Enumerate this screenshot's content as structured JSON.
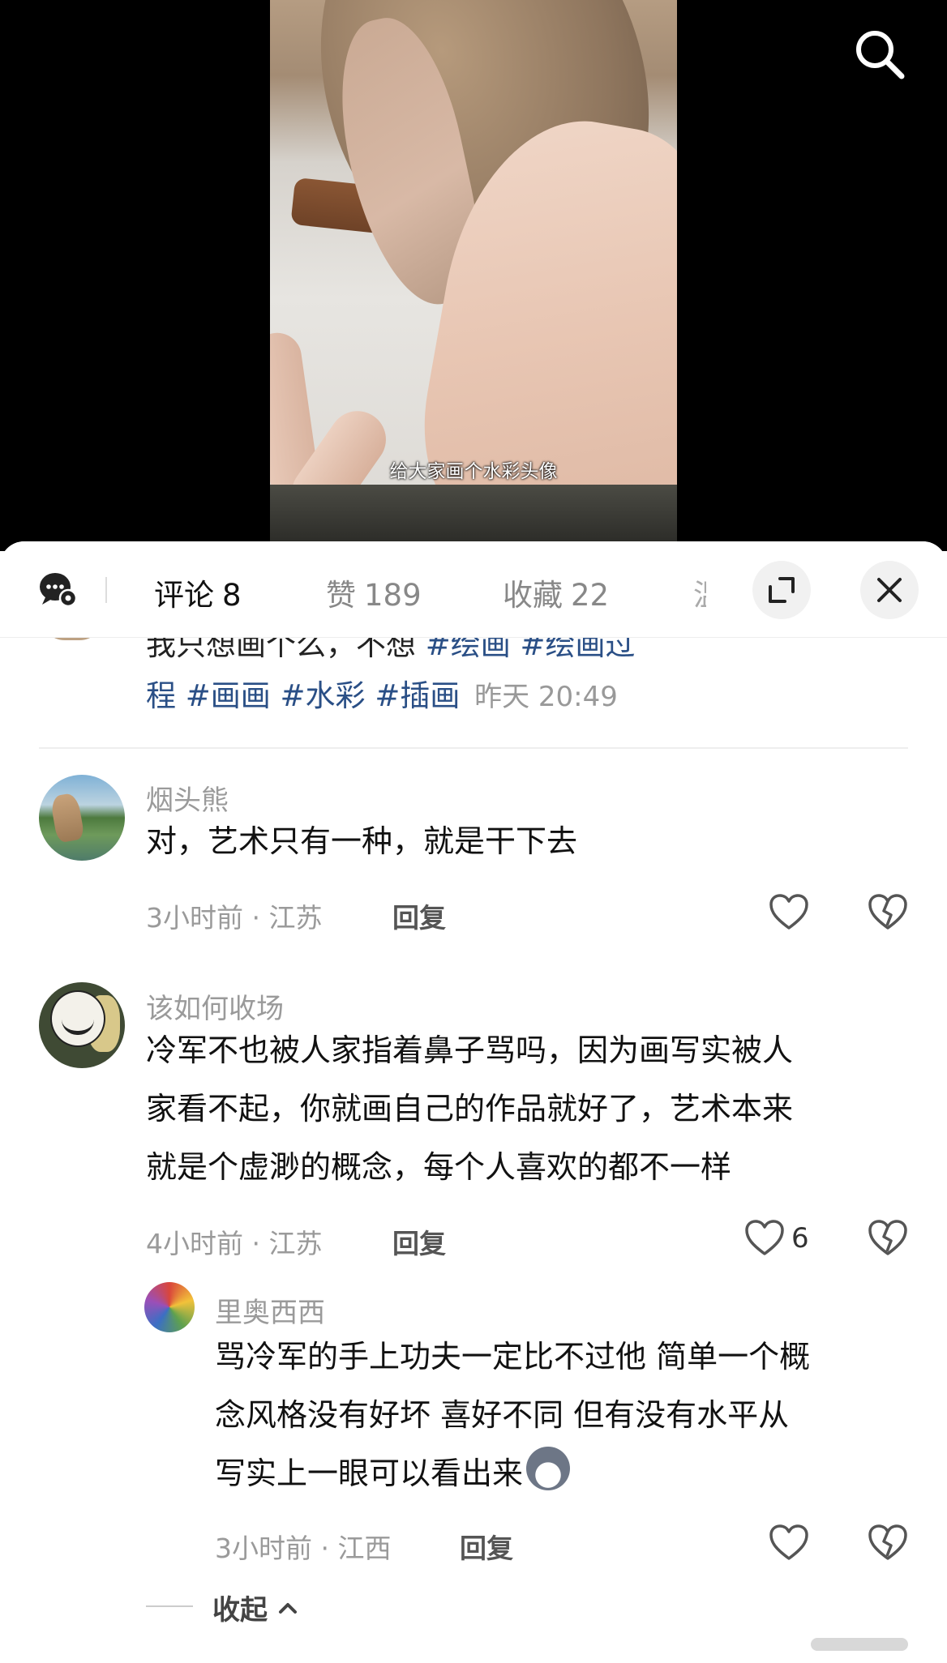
{
  "video": {
    "subtitle": "给大家画个水彩头像"
  },
  "comments_panel": {
    "tabs": [
      {
        "label": "评论",
        "count": "8"
      },
      {
        "label": "赞",
        "count": "189"
      },
      {
        "label": "收藏",
        "count": "22"
      },
      {
        "label": "温",
        "count": ""
      }
    ],
    "post": {
      "cut_line_dark": "我只想画个么，不想",
      "cut_line_tags": "#绘画 #绘画过",
      "line_start": "程",
      "tags": [
        "#画画",
        "#水彩",
        "#插画"
      ],
      "time": "昨天 20:49"
    },
    "comments": [
      {
        "name": "烟头熊",
        "lines": [
          "对，艺术只有一种，就是干下去"
        ],
        "meta": "3小时前 · 江苏",
        "reply_label": "回复",
        "likes": ""
      },
      {
        "name": "该如何收场",
        "lines": [
          "冷军不也被人家指着鼻子骂吗，因为画写实被人",
          "家看不起，你就画自己的作品就好了，艺术本来",
          "就是个虚渺的概念，每个人喜欢的都不一样"
        ],
        "meta": "4小时前 · 江苏",
        "reply_label": "回复",
        "likes": "6",
        "replies": [
          {
            "name": "里奥西西",
            "lines": [
              "骂冷军的手上功夫一定比不过他 简单一个概",
              "念风格没有好坏 喜好不同 但有没有水平从",
              "写实上一眼可以看出来"
            ],
            "emoji": "dog-emoji",
            "meta": "3小时前 · 江西",
            "reply_label": "回复"
          }
        ]
      }
    ],
    "collapse_label": "收起"
  },
  "icons": [
    "search-icon",
    "chat-settings-icon",
    "expand-icon",
    "close-icon",
    "heart-icon",
    "dislike-icon",
    "chevron-up-icon"
  ]
}
